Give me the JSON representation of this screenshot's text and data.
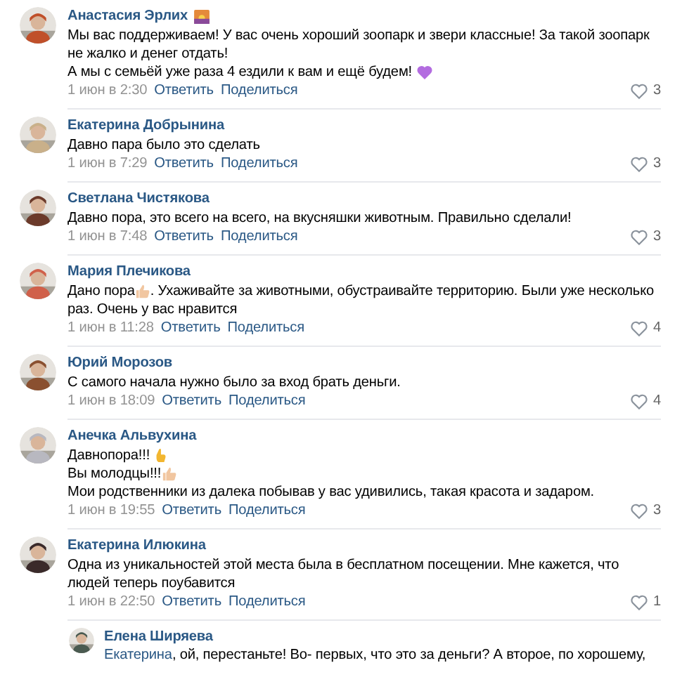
{
  "comments": [
    {
      "author": "Анастасия Эрлих",
      "author_badge": true,
      "lines": [
        [
          {
            "kind": "text",
            "text": "Мы вас поддерживаем! У вас очень хороший зоопарк и звери классные! За такой зоопарк"
          }
        ],
        [
          {
            "kind": "text",
            "text": "не жалко и денег отдать!"
          }
        ],
        [
          {
            "kind": "text",
            "text": "А мы с семьёй уже раза 4 ездили к вам и ещё будем! "
          },
          {
            "kind": "heart"
          }
        ]
      ],
      "date": "1 июн в 2:30",
      "reply": "Ответить",
      "share": "Поделиться",
      "likes": "3"
    },
    {
      "author": "Екатерина Добрынина",
      "author_badge": false,
      "lines": [
        [
          {
            "kind": "text",
            "text": "Давно пара было это сделать"
          }
        ]
      ],
      "date": "1 июн в 7:29",
      "reply": "Ответить",
      "share": "Поделиться",
      "likes": "3"
    },
    {
      "author": "Светлана Чистякова",
      "author_badge": false,
      "lines": [
        [
          {
            "kind": "text",
            "text": "Давно пора, это всего на всего, на вкусняшки животным. Правильно сделали!"
          }
        ]
      ],
      "date": "1 июн в 7:48",
      "reply": "Ответить",
      "share": "Поделиться",
      "likes": "3"
    },
    {
      "author": "Мария Плечикова",
      "author_badge": false,
      "lines": [
        [
          {
            "kind": "text",
            "text": "Дано пора"
          },
          {
            "kind": "thumb"
          },
          {
            "kind": "text",
            "text": ". Ухаживайте за животными, обустраивайте территорию. Были уже несколько"
          }
        ],
        [
          {
            "kind": "text",
            "text": "раз. Очень у вас нравится"
          }
        ]
      ],
      "date": "1 июн в 11:28",
      "reply": "Ответить",
      "share": "Поделиться",
      "likes": "4"
    },
    {
      "author": "Юрий Морозов",
      "author_badge": false,
      "lines": [
        [
          {
            "kind": "text",
            "text": "С самого начала нужно было за вход брать деньги."
          }
        ]
      ],
      "date": "1 июн в 18:09",
      "reply": "Ответить",
      "share": "Поделиться",
      "likes": "4"
    },
    {
      "author": "Анечка Альвухина",
      "author_badge": false,
      "lines": [
        [
          {
            "kind": "text",
            "text": "Давнопора!!! "
          },
          {
            "kind": "hand"
          }
        ],
        [
          {
            "kind": "text",
            "text": "Вы молодцы!!!"
          },
          {
            "kind": "thumb"
          }
        ],
        [
          {
            "kind": "text",
            "text": "Мои родственники из далека побывав у вас удивились, такая красота и задаром."
          }
        ]
      ],
      "date": "1 июн в 19:55",
      "reply": "Ответить",
      "share": "Поделиться",
      "likes": "3"
    },
    {
      "author": "Екатерина Илюкина",
      "author_badge": false,
      "lines": [
        [
          {
            "kind": "text",
            "text": "Одна из уникальностей этой места была в бесплатном посещении. Мне кажется, что"
          }
        ],
        [
          {
            "kind": "text",
            "text": "людей теперь поубавится"
          }
        ]
      ],
      "date": "1 июн в 22:50",
      "reply": "Ответить",
      "share": "Поделиться",
      "likes": "1",
      "replies": [
        {
          "author": "Елена Ширяева",
          "mention": "Екатерина",
          "text": ", ой, перестаньте! Во- первых, что это за деньги? А второе, по хорошему,"
        }
      ]
    }
  ]
}
